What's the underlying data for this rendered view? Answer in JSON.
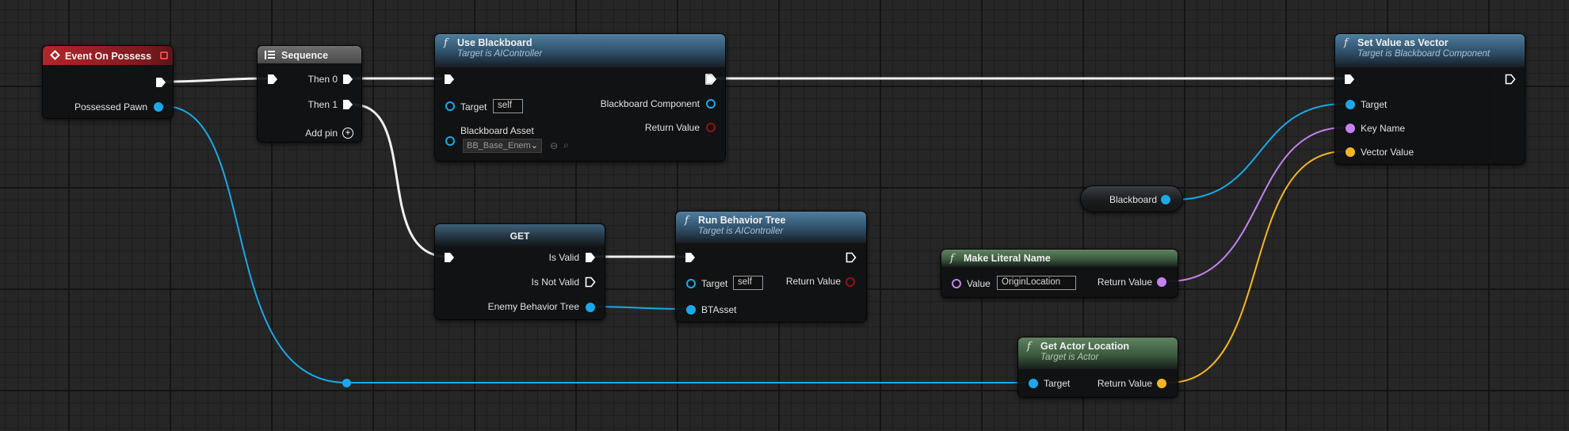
{
  "colors": {
    "exec_wire": "#f0f0f0",
    "object_wire": "#1aa9e8",
    "name_wire": "#c383f0",
    "vector_wire": "#f6b623"
  },
  "event_on_possess": {
    "title": "Event On Possess",
    "pin_possessed_pawn": "Possessed Pawn"
  },
  "sequence": {
    "title": "Sequence",
    "then0": "Then 0",
    "then1": "Then 1",
    "add_pin": "Add pin"
  },
  "use_blackboard": {
    "title": "Use Blackboard",
    "subtitle": "Target is AIController",
    "target_label": "Target",
    "target_value": "self",
    "asset_label": "Blackboard Asset",
    "asset_value": "BB_Base_Enem",
    "out_component": "Blackboard Component",
    "out_return": "Return Value"
  },
  "get_node": {
    "title": "GET",
    "is_valid": "Is Valid",
    "is_not_valid": "Is Not Valid",
    "enemy_tree": "Enemy Behavior Tree"
  },
  "run_behavior_tree": {
    "title": "Run Behavior Tree",
    "subtitle": "Target is AIController",
    "target_label": "Target",
    "target_value": "self",
    "btasset": "BTAsset",
    "out_return": "Return Value"
  },
  "blackboard_var": {
    "label": "Blackboard"
  },
  "make_literal_name": {
    "title": "Make Literal Name",
    "value_label": "Value",
    "value": "OriginLocation",
    "out_return": "Return Value"
  },
  "get_actor_location": {
    "title": "Get Actor Location",
    "subtitle": "Target is Actor",
    "target_label": "Target",
    "out_return": "Return Value"
  },
  "set_value_as_vector": {
    "title": "Set Value as Vector",
    "subtitle": "Target is Blackboard Component",
    "target_label": "Target",
    "key_name": "Key Name",
    "vector_value": "Vector Value"
  }
}
